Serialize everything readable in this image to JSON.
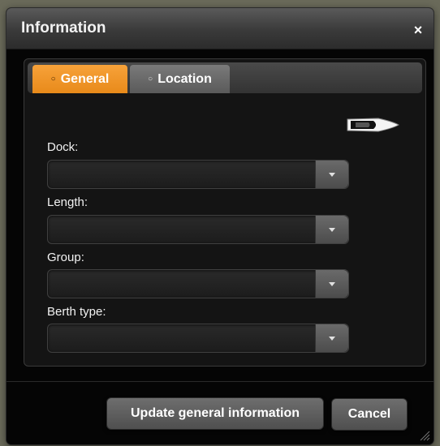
{
  "dialog": {
    "title": "Information",
    "close_symbol": "×",
    "close_icon": "close-icon"
  },
  "tabs": [
    {
      "label": "General",
      "active": true
    },
    {
      "label": "Location",
      "active": false
    }
  ],
  "boat_icon": "boat-icon",
  "fields": [
    {
      "label": "Dock:",
      "value": ""
    },
    {
      "label": "Length:",
      "value": ""
    },
    {
      "label": "Group:",
      "value": ""
    },
    {
      "label": "Berth type:",
      "value": ""
    }
  ],
  "buttons": {
    "update_label": "Update general information",
    "cancel_label": "Cancel"
  },
  "colors": {
    "accent": "#F0952A",
    "background": "#050505",
    "text": "#F2F2F2"
  }
}
